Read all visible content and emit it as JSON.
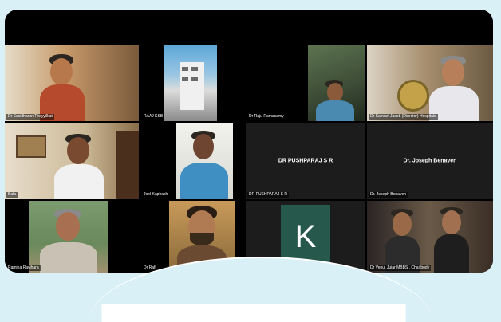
{
  "meeting": {
    "participants": [
      {
        "name": "Dr Sasidharan Thayyilkat",
        "kind": "video"
      },
      {
        "name": "RAAJ KSB",
        "kind": "video"
      },
      {
        "name": "Dr Raju Ramasamy",
        "kind": "video"
      },
      {
        "name": "Dr Samuel Jacob (Director) Hospitals",
        "kind": "video"
      },
      {
        "name": "Bala",
        "kind": "video"
      },
      {
        "name": "Joel Kaphash",
        "kind": "video"
      },
      {
        "name": "DR PUSHPARAJ S R",
        "kind": "name-only",
        "display": "DR PUSHPARAJ S R"
      },
      {
        "name": "Dr. Joseph Benaven",
        "kind": "name-only",
        "display": "Dr. Joseph Benaven"
      },
      {
        "name": "Ramina Ravihara",
        "kind": "video"
      },
      {
        "name": "Dr Rafi",
        "kind": "video"
      },
      {
        "name": "",
        "kind": "avatar",
        "initial": "K"
      },
      {
        "name": "Dr Venu, Jujar MBBS , Chairbody",
        "kind": "video"
      }
    ]
  },
  "colors": {
    "background": "#d9f1f6",
    "avatar_k": "#27584c"
  }
}
